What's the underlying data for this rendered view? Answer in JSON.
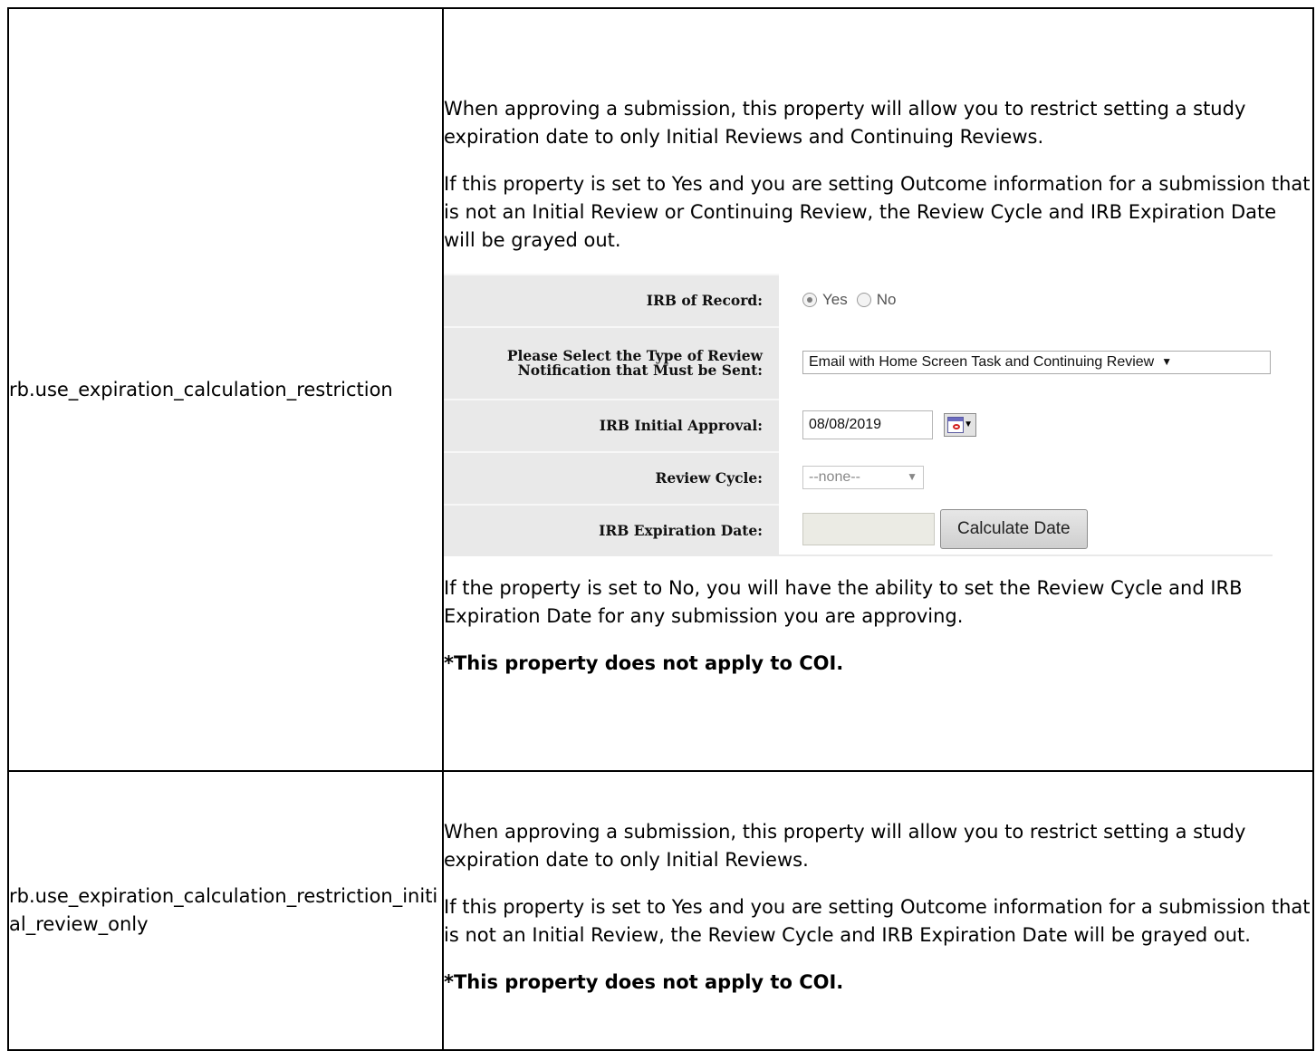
{
  "rows": [
    {
      "property": "rb.use_expiration_calculation_restriction",
      "paragraphs": [
        "When approving a submission, this property will allow you to restrict setting a study expiration date to only Initial Reviews and Continuing Reviews.",
        "If this property is set to Yes and you are setting Outcome information for a submission that is not an Initial Review or Continuing Review, the Review Cycle and IRB Expiration Date will be grayed out."
      ],
      "after_paragraphs": [
        "If the property is set to No, you will have the ability to set the Review Cycle and IRB Expiration Date for any submission you are approving."
      ],
      "note": "*This property does not apply to COI."
    },
    {
      "property": "rb.use_expiration_calculation_restriction_initial_review_only",
      "paragraphs": [
        "When approving a submission, this property will allow you to restrict setting a study expiration date to only Initial Reviews.",
        "If this property is set to Yes and you are setting Outcome information for a submission that is not an Initial Review, the Review Cycle and IRB Expiration Date will be grayed out."
      ],
      "note": "*This property does not apply to COI."
    }
  ],
  "form": {
    "irb_of_record_label": "IRB of Record:",
    "radio_yes": "Yes",
    "radio_no": "No",
    "radio_selected": "Yes",
    "review_type_label_line1": "Please Select the Type of Review",
    "review_type_label_line2": "Notification that Must be Sent:",
    "review_type_value": "Email with Home Screen Task and Continuing Review",
    "initial_approval_label": "IRB Initial Approval:",
    "initial_approval_value": "08/08/2019",
    "review_cycle_label": "Review Cycle:",
    "review_cycle_value": "--none--",
    "expiration_label": "IRB Expiration Date:",
    "expiration_value": "",
    "calculate_button": "Calculate Date",
    "icons": {
      "calendar": "calendar-icon",
      "dropdown": "chevron-down-icon"
    }
  }
}
